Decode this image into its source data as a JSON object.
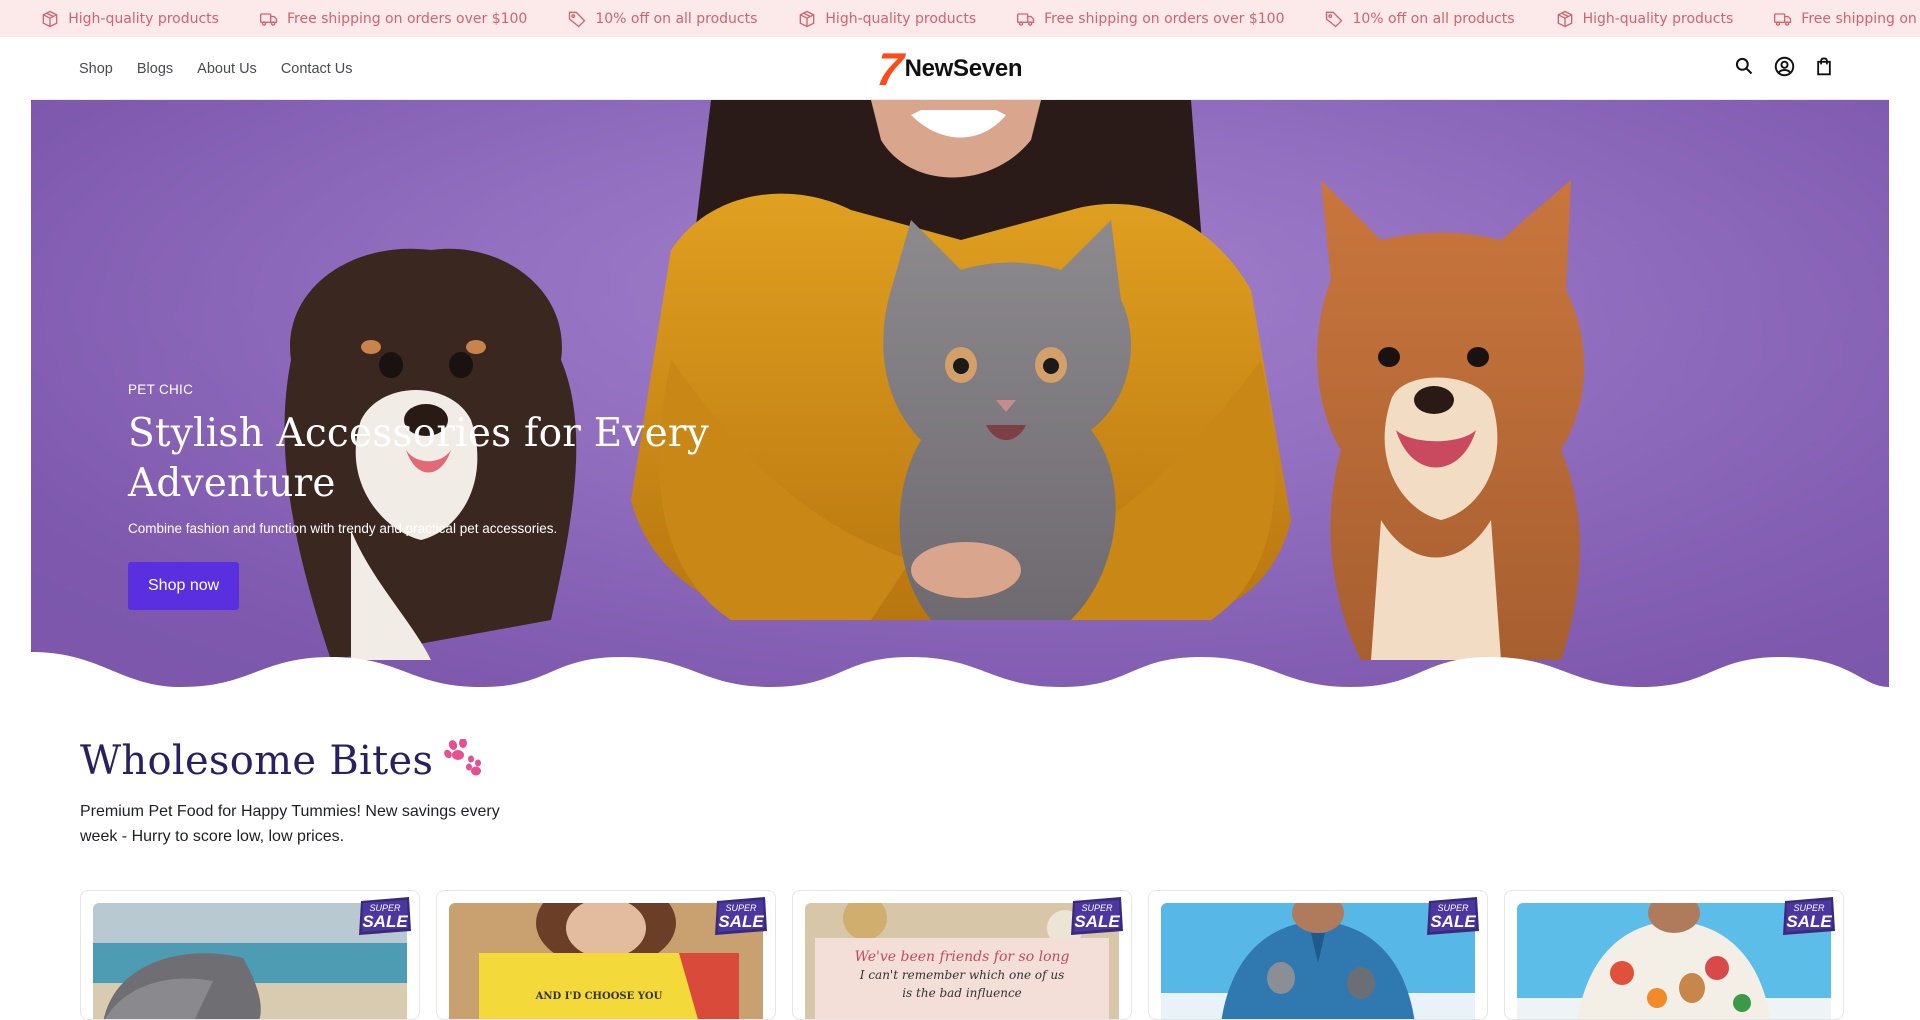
{
  "announcement": {
    "items": [
      {
        "icon": "box-icon",
        "text": "High-quality products"
      },
      {
        "icon": "truck-icon",
        "text": "Free shipping on orders over $100"
      },
      {
        "icon": "tag-icon",
        "text": "10% off on all products"
      }
    ],
    "partial_left": "ducts",
    "partial_right": "Free shipping on"
  },
  "nav": {
    "shop": "Shop",
    "blogs": "Blogs",
    "about": "About Us",
    "contact": "Contact Us"
  },
  "brand": {
    "mark": "7",
    "name": "NewSeven"
  },
  "hero": {
    "kicker": "PET CHIC",
    "title": "Stylish Accessories for Every Adventure",
    "subtitle": "Combine fashion and function with trendy and practical pet accessories.",
    "cta": "Shop now"
  },
  "section": {
    "title": "Wholesome Bites",
    "description": "Premium Pet Food for Happy Tummies! New savings every week - Hurry to score low, low prices."
  },
  "products": [
    {
      "badge_top": "SUPER",
      "badge_main": "SALE",
      "thumb": "beach-cap"
    },
    {
      "badge_top": "SUPER",
      "badge_main": "SALE",
      "thumb": "pillow-girl"
    },
    {
      "badge_top": "SUPER",
      "badge_main": "SALE",
      "thumb": "friends-pillow"
    },
    {
      "badge_top": "SUPER",
      "badge_main": "SALE",
      "thumb": "husky-shirt"
    },
    {
      "badge_top": "SUPER",
      "badge_main": "SALE",
      "thumb": "floral-shirt"
    }
  ],
  "pillow_text": {
    "line1": "We've been friends for so long",
    "line2": "I can't remember which one of us",
    "line3": "is the bad influence"
  },
  "pillow2_text": "AND I'D CHOOSE YOU",
  "colors": {
    "accent": "#5a2fe0",
    "announce_bg": "#fce9ea",
    "announce_text": "#d2646f",
    "heading": "#2a1f5f",
    "hero_bg": "#8d69bb"
  }
}
